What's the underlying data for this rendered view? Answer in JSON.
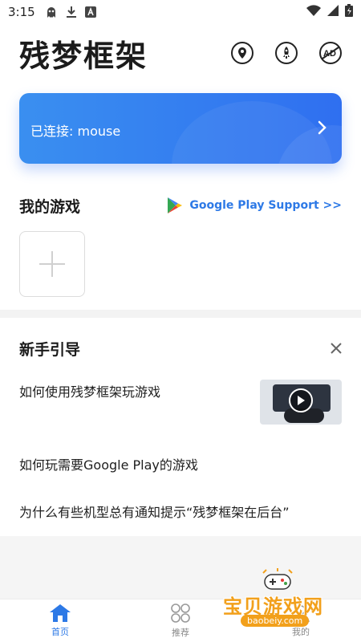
{
  "status_bar": {
    "time": "3:15"
  },
  "header": {
    "title": "残梦框架"
  },
  "connection": {
    "label": "已连接: mouse"
  },
  "my_games": {
    "title": "我的游戏",
    "google_play_link": "Google Play Support >>"
  },
  "guide": {
    "title": "新手引导",
    "items": [
      "如何使用残梦框架玩游戏",
      "如何玩需要Google Play的游戏",
      "为什么有些机型总有通知提示“残梦框架在后台”"
    ]
  },
  "bottom_nav": {
    "items": [
      {
        "label": "首页",
        "icon": "home-icon",
        "active": true
      },
      {
        "label": "推荐",
        "icon": "grid-icon",
        "active": false
      },
      {
        "label": "我的",
        "icon": "profile-icon",
        "active": false
      }
    ]
  },
  "watermark": {
    "text": "宝贝游戏网",
    "url": "baobeiy.com"
  },
  "colors": {
    "accent": "#2d79e6",
    "card_start": "#3a8ff0",
    "card_end": "#2f6ff0",
    "watermark": "#f2a01b"
  }
}
